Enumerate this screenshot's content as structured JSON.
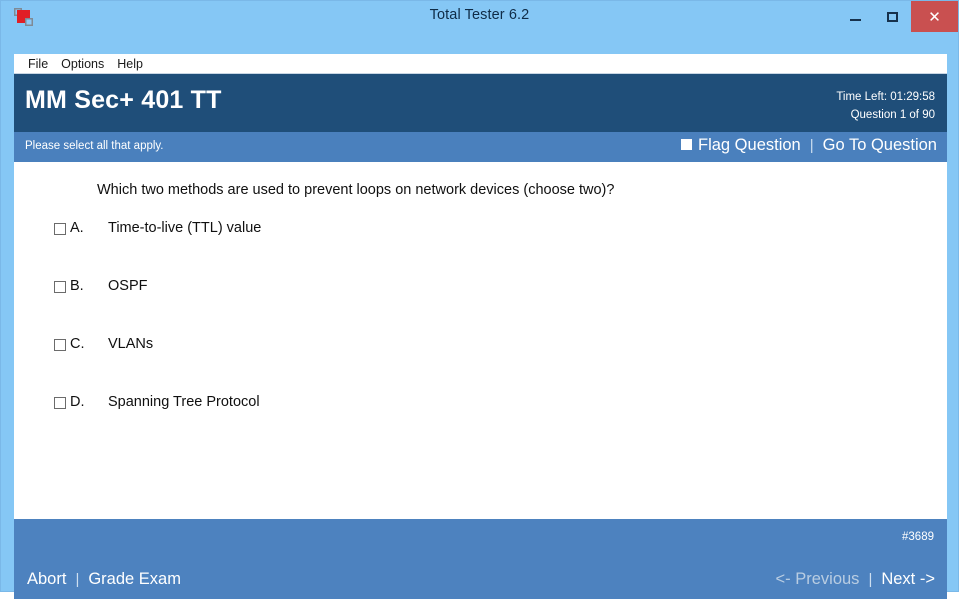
{
  "window": {
    "title": "Total Tester 6.2",
    "icon": "app-logo-icon",
    "controls": {
      "minimize": "–",
      "maximize": "□",
      "close": "✕"
    }
  },
  "menubar": {
    "items": [
      {
        "label": "File"
      },
      {
        "label": "Options"
      },
      {
        "label": "Help"
      }
    ]
  },
  "header": {
    "exam_title": "MM Sec+ 401 TT",
    "time_left": "Time Left:  01:29:58",
    "question_counter": "Question 1 of 90"
  },
  "subbar": {
    "instruction": "Please select all that apply.",
    "flag_label": "Flag Question",
    "separator": "|",
    "goto_label": "Go To Question"
  },
  "question": {
    "text": "Which two methods are used to prevent loops on network devices (choose two)?",
    "choices": [
      {
        "letter": "A.",
        "text": "Time-to-live (TTL) value",
        "checked": false
      },
      {
        "letter": "B.",
        "text": "OSPF",
        "checked": false
      },
      {
        "letter": "C.",
        "text": "VLANs",
        "checked": false
      },
      {
        "letter": "D.",
        "text": "Spanning Tree Protocol",
        "checked": false
      }
    ]
  },
  "footer": {
    "question_id": "#3689",
    "abort_label": "Abort",
    "separator": "|",
    "grade_label": "Grade Exam",
    "previous_label": "<- Previous",
    "nav_separator": "|",
    "next_label": "Next ->"
  },
  "colors": {
    "window_frame": "#85c7f5",
    "header_dark_blue": "#1f4e79",
    "subbar_blue": "#4a80bd",
    "footer_blue": "#4d82bf",
    "close_red": "#c95050",
    "disabled_text": "#b9cde2"
  }
}
